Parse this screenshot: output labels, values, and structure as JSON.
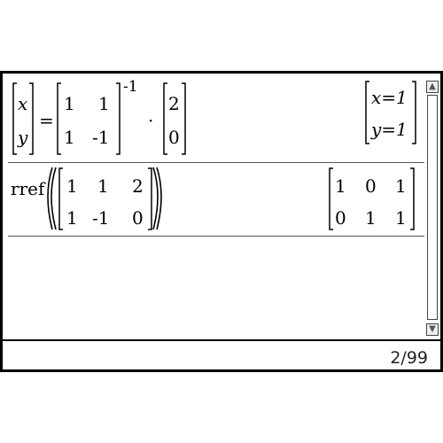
{
  "history": [
    {
      "input": {
        "lhs": [
          "x",
          "y"
        ],
        "eq": "=",
        "matrix": [
          [
            "1",
            "1"
          ],
          [
            "1",
            "-1"
          ]
        ],
        "exponent": "-1",
        "op": "·",
        "vector": [
          "2",
          "0"
        ]
      },
      "output": [
        "x=1",
        "y=1"
      ]
    },
    {
      "input": {
        "fn": "rref",
        "matrix": [
          [
            "1",
            "1",
            "2"
          ],
          [
            "1",
            "-1",
            "0"
          ]
        ]
      },
      "output": [
        [
          "1",
          "0",
          "1"
        ],
        [
          "0",
          "1",
          "1"
        ]
      ]
    }
  ],
  "status": {
    "page": "2/99"
  },
  "scrollbar": {
    "up": "▲",
    "down": "▼"
  }
}
